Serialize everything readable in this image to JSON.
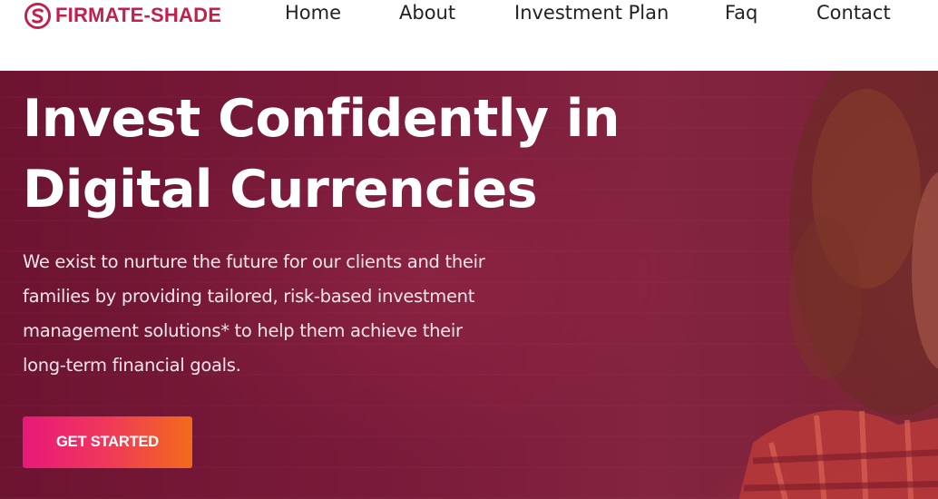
{
  "brand": {
    "name": "FIRMATE-SHADE",
    "logo_icon": "s-circle-logo-icon",
    "color": "#c41f4a"
  },
  "nav": {
    "items": [
      {
        "label": "Home"
      },
      {
        "label": "About"
      },
      {
        "label": "Investment Plan"
      },
      {
        "label": "Faq"
      },
      {
        "label": "Contact"
      }
    ]
  },
  "hero": {
    "title_line1": "Invest Confidently in",
    "title_line2": "Digital Currencies",
    "text": "We exist to nurture the future for our clients and their families by providing tailored, risk-based investment management solutions* to help them achieve their long-term financial goals.",
    "cta_label": "GET STARTED",
    "overlay_color": "#7a1a3a",
    "cta_gradient_start": "#e8197a",
    "cta_gradient_end": "#f26b1a"
  }
}
